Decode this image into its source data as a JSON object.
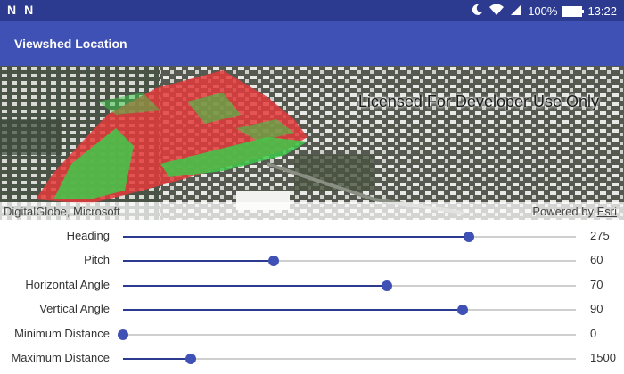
{
  "status_bar": {
    "left_icons": [
      "N",
      "N"
    ],
    "battery": "100%",
    "time": "13:22",
    "icons": [
      "moon-icon",
      "wifi-icon",
      "signal-icon",
      "battery-icon"
    ]
  },
  "app_bar": {
    "title": "Viewshed Location"
  },
  "map": {
    "license_text": "Licensed For Developer Use Only",
    "attribution": "DigitalGlobe, Microsoft",
    "powered_by": "Powered by",
    "esri": "Esri"
  },
  "sliders": [
    {
      "label": "Heading",
      "value": "275",
      "fraction": 0.764
    },
    {
      "label": "Pitch",
      "value": "60",
      "fraction": 0.333
    },
    {
      "label": "Horizontal Angle",
      "value": "70",
      "fraction": 0.583
    },
    {
      "label": "Vertical Angle",
      "value": "90",
      "fraction": 0.75
    },
    {
      "label": "Minimum Distance",
      "value": "0",
      "fraction": 0.0
    },
    {
      "label": "Maximum Distance",
      "value": "1500",
      "fraction": 0.15
    }
  ],
  "colors": {
    "status_bar": "#2c3a8f",
    "app_bar": "#3f51b5",
    "accent": "#3f51b5",
    "visible_area": "#3ec94a",
    "hidden_area": "#e33b3b"
  }
}
